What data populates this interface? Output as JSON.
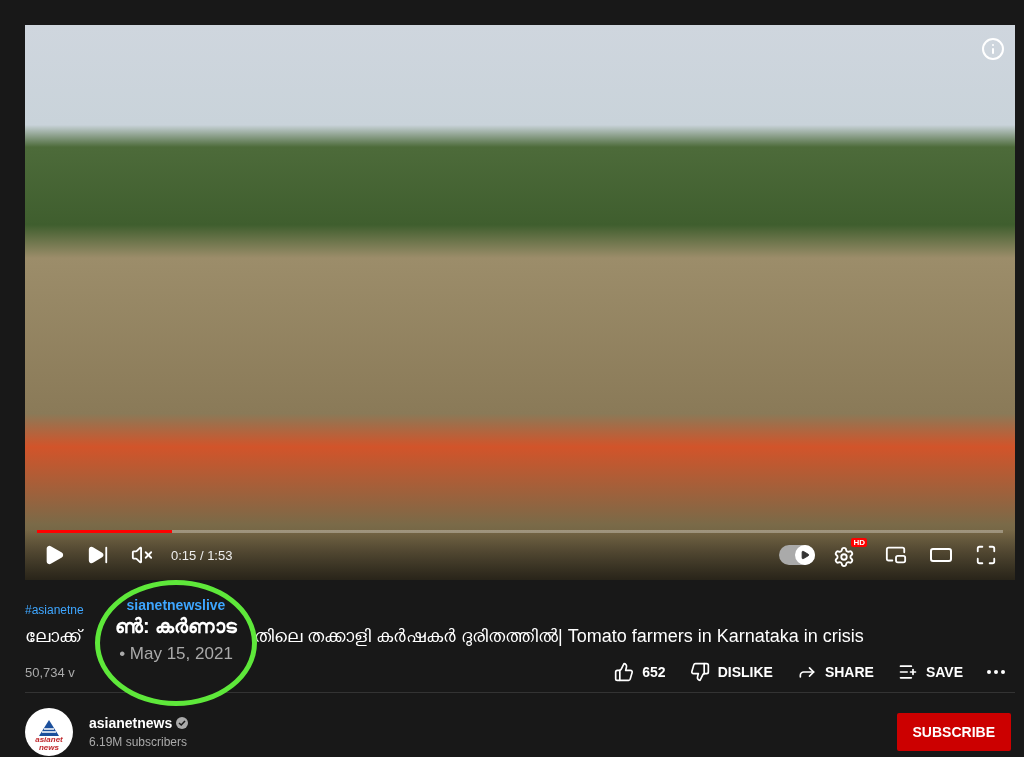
{
  "player": {
    "progress": {
      "level": 0.14
    },
    "time": "0:15 / 1:53",
    "muted": true,
    "autoplay": {
      "on": true
    },
    "quality_badge": "HD"
  },
  "video": {
    "hashtag": "#asianetne",
    "title_start": "ലോക്ക്",
    "title_end": "തിലെ തക്കാളി കർഷകർ ദുരിതത്തിൽ| Tomato farmers in Karnataka in crisis",
    "views": "50,734 v",
    "actions": [
      {
        "kind": "like",
        "label": "652"
      },
      {
        "kind": "dislike",
        "label": "DISLIKE"
      },
      {
        "kind": "share",
        "label": "SHARE"
      },
      {
        "kind": "save",
        "label": "SAVE"
      },
      {
        "kind": "more"
      }
    ]
  },
  "channel": {
    "logo_text": [
      "asianet",
      "news"
    ],
    "name": "asianetnews",
    "verified": true,
    "subscribers": "6.19M subscribers",
    "subscribe_button": "SUBSCRIBE"
  },
  "annotation_circle": {
    "channel_tag": "sianetnewslive",
    "title": "ൺ: കർണാട",
    "date": "• May 15, 2021"
  }
}
